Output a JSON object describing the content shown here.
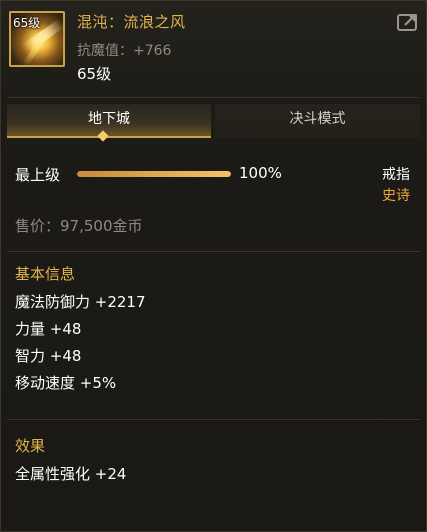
{
  "item": {
    "level_badge": "65级",
    "name": "混沌：流浪之风",
    "magic_resist": "抗魔值：+766",
    "level": "65级"
  },
  "tabs": [
    {
      "label": "地下城",
      "active": true
    },
    {
      "label": "决斗模式",
      "active": false
    }
  ],
  "grade": {
    "label": "最上级",
    "progress": 100,
    "percent_text": "100%"
  },
  "slot": "戒指",
  "rarity": "史诗",
  "price": "售价：97,500金币",
  "basic_info": {
    "title": "基本信息",
    "stats": [
      "魔法防御力 +2217",
      "力量 +48",
      "智力 +48",
      "移动速度 +5%"
    ]
  },
  "effect": {
    "title": "效果",
    "lines": [
      "全属性强化 +24"
    ]
  },
  "colors": {
    "gold": "#e3b44e",
    "epic": "#f0a93a",
    "gray_text": "#8f8a7d"
  },
  "icons": {
    "share": "share-icon",
    "item": "ring-item-icon"
  }
}
